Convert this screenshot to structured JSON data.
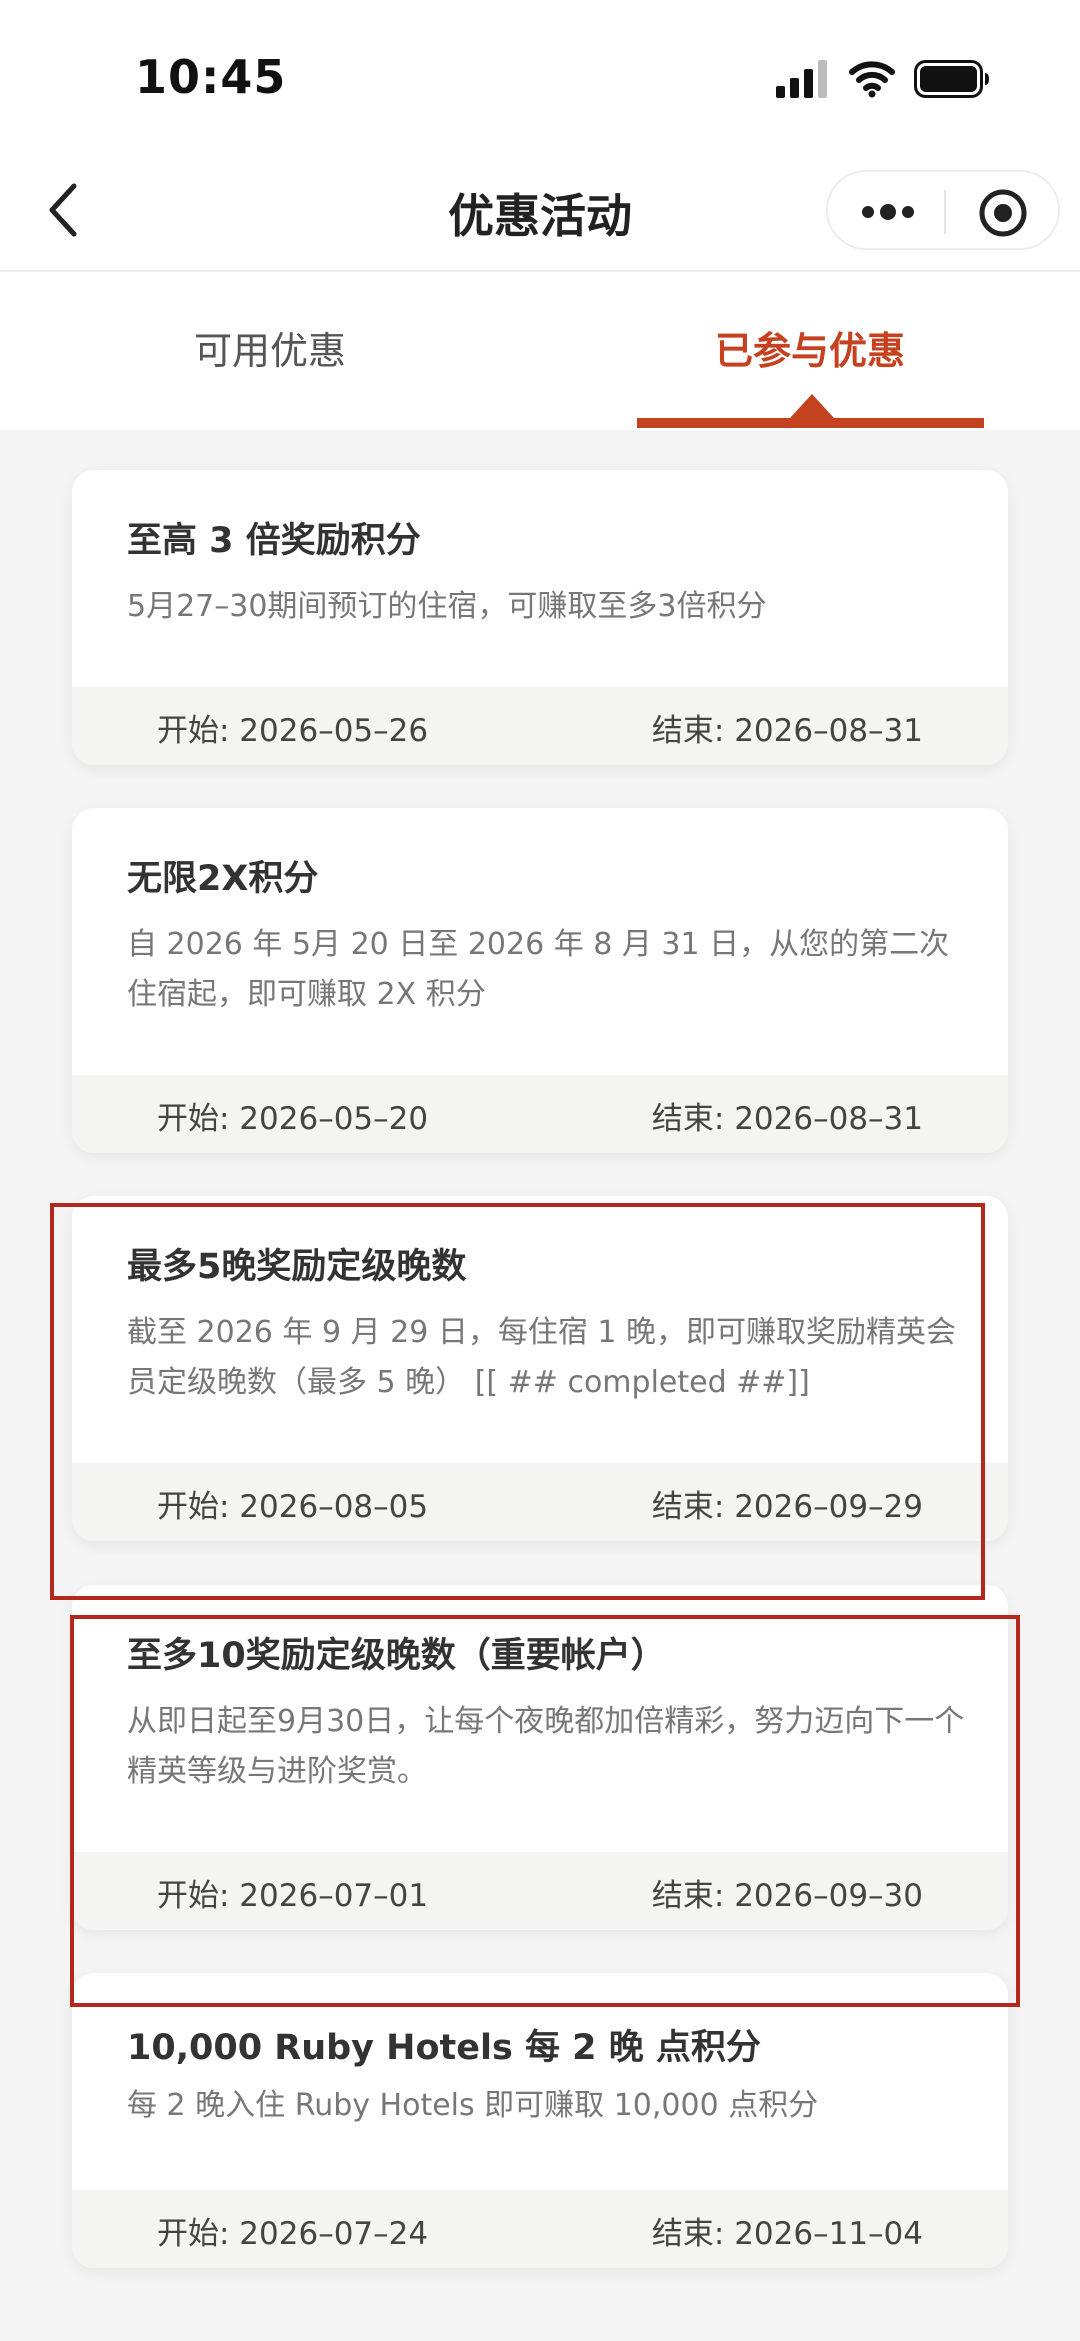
{
  "status_bar": {
    "time": "10:45"
  },
  "nav": {
    "title": "优惠活动"
  },
  "tabs": [
    {
      "label": "可用优惠",
      "active": false
    },
    {
      "label": "已参与优惠",
      "active": true
    }
  ],
  "colors": {
    "accent": "#c4421f",
    "highlight_border": "#b3271c"
  },
  "promotions": [
    {
      "title": "至高 3 倍奖励积分",
      "description": "5月27–30期间预订的住宿，可赚取至多3倍积分",
      "start": "开始: 2026–05–26",
      "end": "结束: 2026–08–31"
    },
    {
      "title": "无限2X积分",
      "description": "自 2026 年 5月 20 日至 2026 年 8 月 31 日，从您的第二次住宿起，即可赚取 2X 积分",
      "start": "开始: 2026–05–20",
      "end": "结束: 2026–08–31"
    },
    {
      "title": "最多5晚奖励定级晚数",
      "description": "截至 2026 年 9 月 29 日，每住宿 1 晚，即可赚取奖励精英会员定级晚数（最多 5 晚） [[ ## completed ##]]",
      "start": "开始: 2026–08–05",
      "end": "结束: 2026–09–29"
    },
    {
      "title": "至多10奖励定级晚数（重要帐户）",
      "description": "从即日起至9月30日，让每个夜晚都加倍精彩，努力迈向下一个精英等级与进阶奖赏。",
      "start": "开始: 2026–07–01",
      "end": "结束: 2026–09–30"
    },
    {
      "title": "10,000 Ruby Hotels 每 2 晚 点积分",
      "description": "每 2 晚入住 Ruby Hotels 即可赚取 10,000 点积分",
      "start": "开始: 2026–07–24",
      "end": "结束: 2026–11–04"
    }
  ]
}
